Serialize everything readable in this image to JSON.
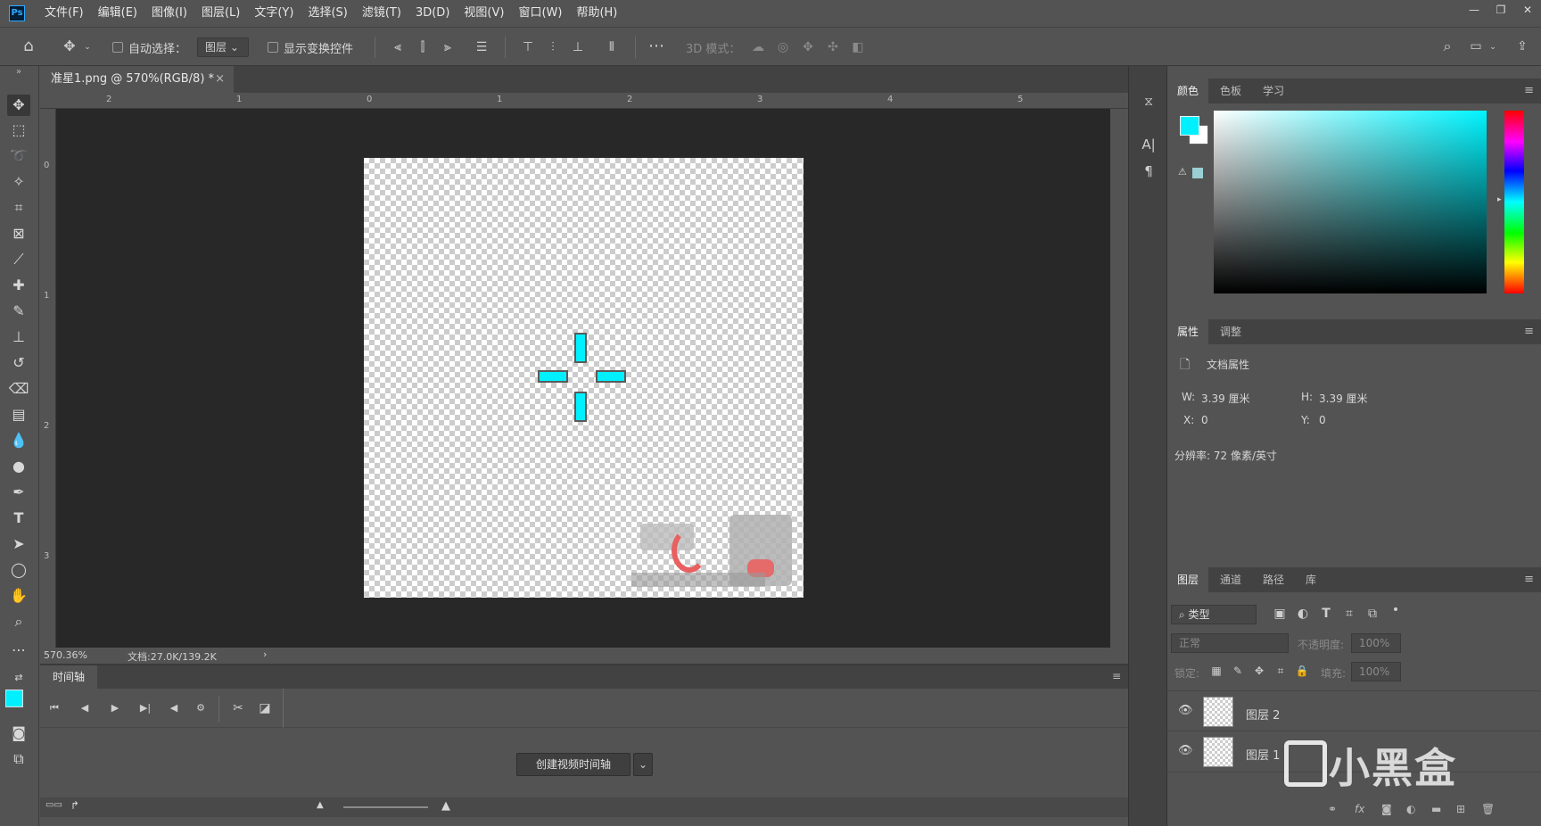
{
  "app": {
    "logo": "Ps"
  },
  "menu": [
    "文件(F)",
    "编辑(E)",
    "图像(I)",
    "图层(L)",
    "文字(Y)",
    "选择(S)",
    "滤镜(T)",
    "3D(D)",
    "视图(V)",
    "窗口(W)",
    "帮助(H)"
  ],
  "options": {
    "auto_select_label": "自动选择：",
    "layer_dropdown": "图层",
    "show_transform_label": "显示变换控件",
    "mode_3d_label": "3D 模式："
  },
  "document": {
    "tab_title": "准星1.png @ 570%(RGB/8) *",
    "zoom": "570.36%",
    "doc_size": "文档:27.0K/139.2K"
  },
  "rulers": {
    "top": [
      "2",
      "1",
      "0",
      "1",
      "2",
      "3",
      "4",
      "5"
    ],
    "left": [
      "0",
      "1",
      "2",
      "3"
    ]
  },
  "timeline": {
    "tab": "时间轴",
    "create_button": "创建视频时间轴"
  },
  "panels": {
    "color_tabs": [
      "颜色",
      "色板",
      "学习"
    ],
    "properties_tabs": [
      "属性",
      "调整"
    ],
    "properties": {
      "title": "文档属性",
      "w_label": "W:",
      "w_value": "3.39 厘米",
      "h_label": "H:",
      "h_value": "3.39 厘米",
      "x_label": "X:",
      "x_value": "0",
      "y_label": "Y:",
      "y_value": "0",
      "resolution": "分辨率: 72 像素/英寸"
    },
    "layers_tabs": [
      "图层",
      "通道",
      "路径",
      "库"
    ],
    "layers_filter": "类型",
    "blend_mode": "正常",
    "opacity_label": "不透明度:",
    "opacity_value": "100%",
    "lock_label": "锁定:",
    "fill_label": "填充:",
    "fill_value": "100%",
    "layers": [
      {
        "name": "图层 2"
      },
      {
        "name": "图层 1"
      }
    ]
  },
  "colors": {
    "foreground": "#00f0ff",
    "background": "#ffffff"
  },
  "watermark": "小黑盒"
}
